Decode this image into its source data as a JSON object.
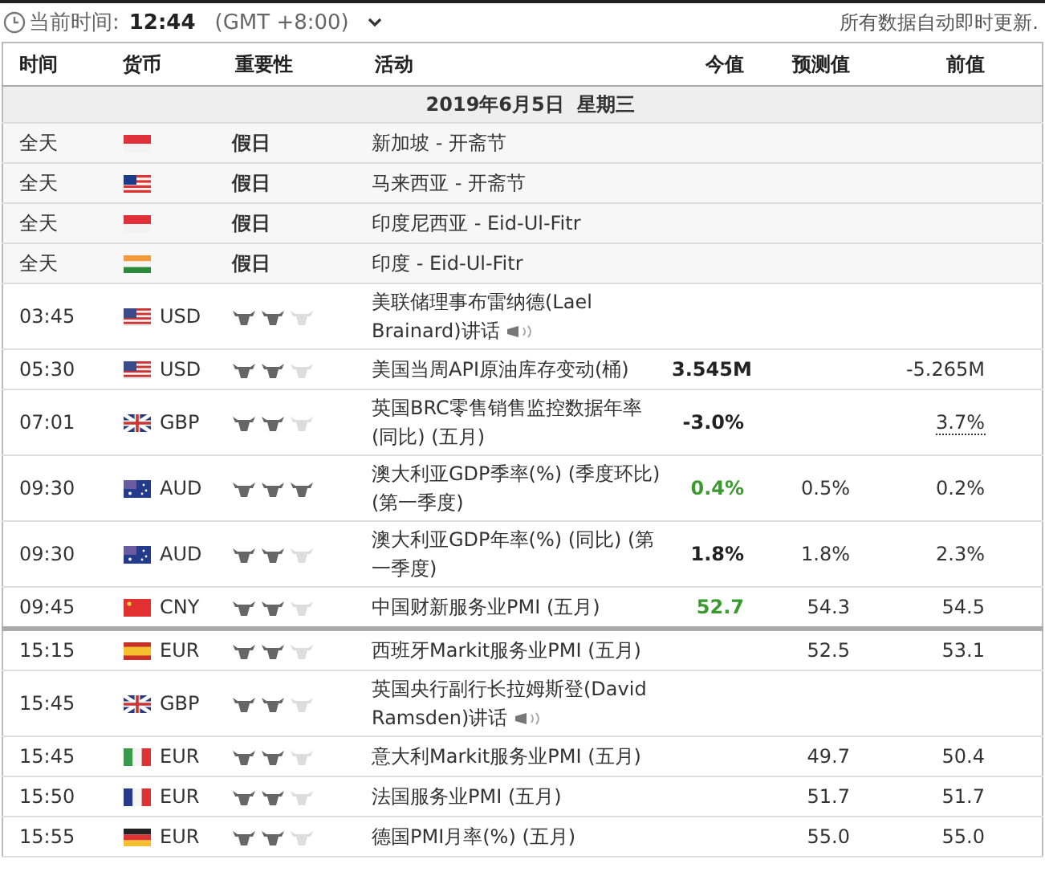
{
  "header": {
    "clock_label": "当前时间:",
    "time": "12:44",
    "timezone": "(GMT +8:00)",
    "notice": "所有数据自动即时更新."
  },
  "table": {
    "columns": [
      "时间",
      "货币",
      "重要性",
      "活动",
      "今值",
      "预测值",
      "前值"
    ],
    "date_row": "2019年6月5日  星期三",
    "rows": [
      {
        "kind": "holiday",
        "time": "全天",
        "flag": {
          "kind": "sg"
        },
        "importance": "假日",
        "event": "新加坡 - 开斋节"
      },
      {
        "kind": "holiday",
        "time": "全天",
        "flag": {
          "kind": "my"
        },
        "importance": "假日",
        "event": "马来西亚 - 开斋节"
      },
      {
        "kind": "holiday",
        "time": "全天",
        "flag": {
          "kind": "id"
        },
        "importance": "假日",
        "event": "印度尼西亚 - Eid-Ul-Fitr"
      },
      {
        "kind": "holiday",
        "time": "全天",
        "flag": {
          "kind": "in"
        },
        "importance": "假日",
        "event": "印度 - Eid-Ul-Fitr"
      },
      {
        "kind": "event",
        "time": "03:45",
        "flag": {
          "kind": "us"
        },
        "currency": "USD",
        "stars": 2,
        "event": "美联储理事布雷纳德(Lael Brainard)讲话",
        "speech": true,
        "divider_after": false
      },
      {
        "kind": "event",
        "time": "05:30",
        "flag": {
          "kind": "us"
        },
        "currency": "USD",
        "stars": 2,
        "event": "美国当周API原油库存变动(桶)",
        "actual": "3.545M",
        "actual_better": false,
        "previous": "-5.265M",
        "speech": false,
        "previous_revised": false,
        "divider_after": false
      },
      {
        "kind": "event",
        "time": "07:01",
        "flag": {
          "kind": "gb"
        },
        "currency": "GBP",
        "stars": 2,
        "event": "英国BRC零售销售监控数据年率 (同比) (五月)",
        "actual": "-3.0%",
        "actual_better": false,
        "previous": "3.7%",
        "speech": false,
        "previous_revised": true,
        "divider_after": false
      },
      {
        "kind": "event",
        "time": "09:30",
        "flag": {
          "kind": "au"
        },
        "currency": "AUD",
        "stars": 3,
        "event": "澳大利亚GDP季率(%) (季度环比) (第一季度)",
        "actual": "0.4%",
        "actual_better": true,
        "forecast": "0.5%",
        "previous": "0.2%",
        "speech": false,
        "previous_revised": false,
        "divider_after": false
      },
      {
        "kind": "event",
        "time": "09:30",
        "flag": {
          "kind": "au"
        },
        "currency": "AUD",
        "stars": 2,
        "event": "澳大利亚GDP年率(%) (同比) (第一季度)",
        "actual": "1.8%",
        "actual_better": false,
        "forecast": "1.8%",
        "previous": "2.3%",
        "speech": false,
        "previous_revised": false,
        "divider_after": false
      },
      {
        "kind": "event",
        "time": "09:45",
        "flag": {
          "kind": "cn"
        },
        "currency": "CNY",
        "stars": 2,
        "event": "中国财新服务业PMI (五月)",
        "actual": "52.7",
        "actual_better": true,
        "forecast": "54.3",
        "previous": "54.5",
        "speech": false,
        "previous_revised": false,
        "divider_after": true
      },
      {
        "kind": "event",
        "time": "15:15",
        "flag": {
          "kind": "es"
        },
        "currency": "EUR",
        "stars": 2,
        "event": "西班牙Markit服务业PMI (五月)",
        "forecast": "52.5",
        "previous": "53.1",
        "speech": false,
        "previous_revised": false,
        "divider_after": false
      },
      {
        "kind": "event",
        "time": "15:45",
        "flag": {
          "kind": "gb"
        },
        "currency": "GBP",
        "stars": 2,
        "event": "英国央行副行长拉姆斯登(David Ramsden)讲话",
        "speech": true,
        "divider_after": false
      },
      {
        "kind": "event",
        "time": "15:45",
        "flag": {
          "kind": "it"
        },
        "currency": "EUR",
        "stars": 2,
        "event": "意大利Markit服务业PMI (五月)",
        "forecast": "49.7",
        "previous": "50.4",
        "speech": false,
        "previous_revised": false,
        "divider_after": false
      },
      {
        "kind": "event",
        "time": "15:50",
        "flag": {
          "kind": "fr"
        },
        "currency": "EUR",
        "stars": 2,
        "event": "法国服务业PMI (五月)",
        "forecast": "51.7",
        "previous": "51.7",
        "speech": false,
        "previous_revised": false,
        "divider_after": false
      },
      {
        "kind": "event",
        "time": "15:55",
        "flag": {
          "kind": "de"
        },
        "currency": "EUR",
        "stars": 2,
        "event": "德国PMI月率(%) (五月)",
        "forecast": "55.0",
        "previous": "55.0",
        "speech": false,
        "previous_revised": false,
        "divider_after": false
      }
    ]
  }
}
